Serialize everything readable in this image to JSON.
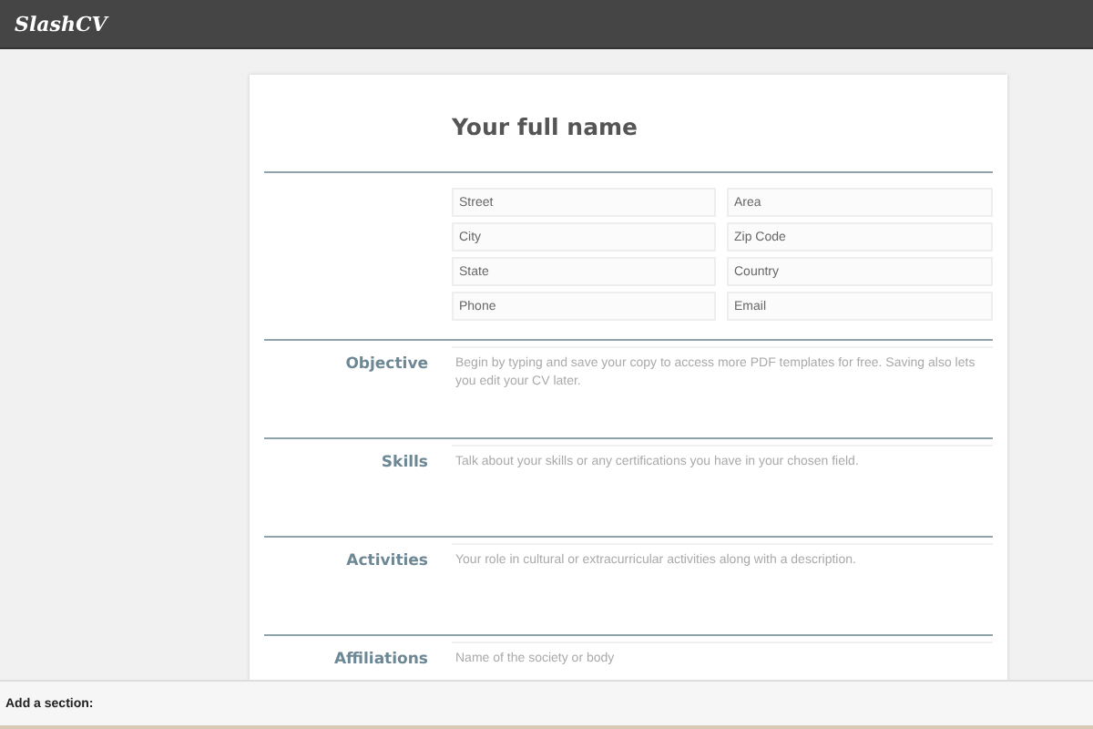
{
  "header": {
    "logo": "SlashCV"
  },
  "resume": {
    "name_placeholder": "Your full name",
    "contact_fields": [
      {
        "placeholder": "Street"
      },
      {
        "placeholder": "Area"
      },
      {
        "placeholder": "City"
      },
      {
        "placeholder": "Zip Code"
      },
      {
        "placeholder": "State"
      },
      {
        "placeholder": "Country"
      },
      {
        "placeholder": "Phone"
      },
      {
        "placeholder": "Email"
      }
    ],
    "sections": [
      {
        "label": "Objective",
        "placeholder": "Begin by typing and save your copy to access more PDF templates for free. Saving also lets you edit your CV later."
      },
      {
        "label": "Skills",
        "placeholder": "Talk about your skills or any certifications you have in your chosen field."
      },
      {
        "label": "Activities",
        "placeholder": "Your role in cultural or extracurricular activities along with a description."
      },
      {
        "label": "Affiliations",
        "placeholder": "Name of the society or body"
      }
    ]
  },
  "footer": {
    "label": "Add a section:"
  }
}
